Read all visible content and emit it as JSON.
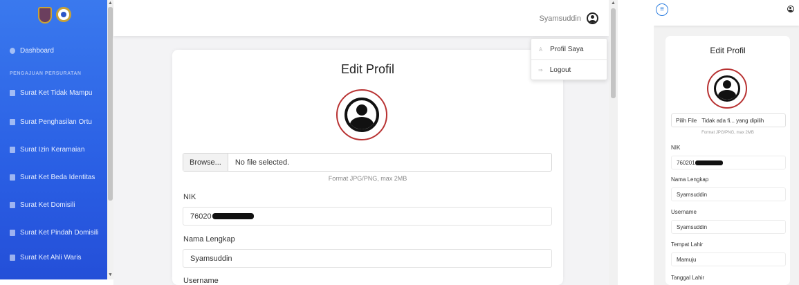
{
  "sidebar": {
    "dashboard": "Dashboard",
    "section_title": "PENGAJUAN PERSURATAN",
    "items": [
      {
        "label": "Surat Ket Tidak Mampu"
      },
      {
        "label": "Surat Penghasilan Ortu"
      },
      {
        "label": "Surat Izin Keramaian"
      },
      {
        "label": "Surat Ket Beda Identitas"
      },
      {
        "label": "Surat Ket Domisili"
      },
      {
        "label": "Surat Ket Pindah Domisili"
      },
      {
        "label": "Surat Ket Ahli Waris"
      }
    ]
  },
  "header": {
    "username": "Syamsuddin"
  },
  "user_menu": {
    "profile": "Profil Saya",
    "logout": "Logout"
  },
  "form": {
    "title": "Edit Profil",
    "file_button": "Browse...",
    "file_status": "No file selected.",
    "file_hint": "Format JPG/PNG, max 2MB",
    "nik_label": "NIK",
    "nik_value": "76020",
    "nama_label": "Nama Lengkap",
    "nama_value": "Syamsuddin",
    "username_label": "Username"
  },
  "mobile": {
    "title": "Edit Profil",
    "file_button": "Pilih File",
    "file_status": "Tidak ada fi... yang dipilih",
    "file_hint": "Format JPG/PNG, max 2MB",
    "nik_label": "NIK",
    "nik_value": "760201",
    "nama_label": "Nama Lengkap",
    "nama_value": "Syamsuddin",
    "username_label": "Username",
    "username_value": "Syamsuddin",
    "tempat_label": "Tempat Lahir",
    "tempat_value": "Mamuju",
    "tanggal_label": "Tanggal Lahir"
  },
  "colors": {
    "sidebar": "#2a5fe4",
    "avatar_ring": "#b83232",
    "mobile_menu": "#2f7fe0"
  }
}
